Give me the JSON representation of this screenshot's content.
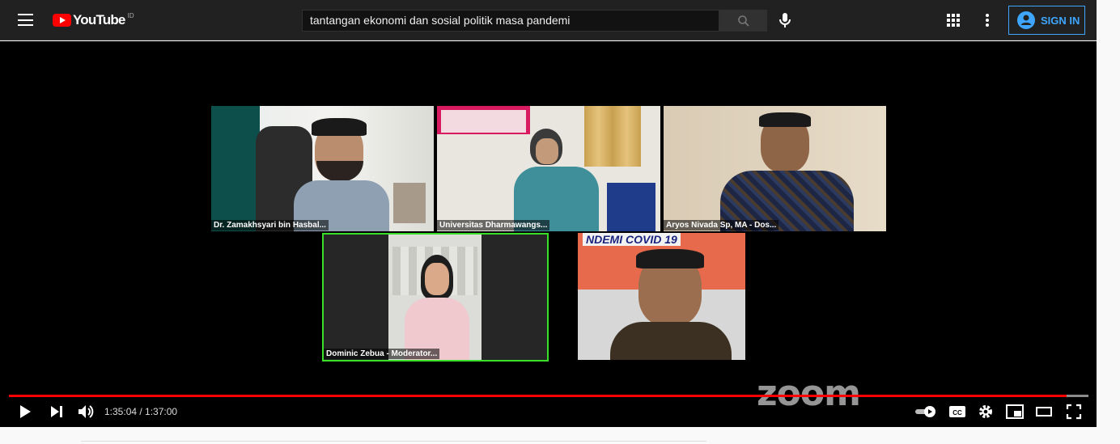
{
  "header": {
    "logo_text": "YouTube",
    "country_code": "ID",
    "search_value": "tantangan ekonomi dan sosial politik masa pandemi",
    "signin_label": "SIGN IN"
  },
  "meeting": {
    "participants": [
      {
        "name": "Dr. Zamakhsyari bin Hasbal..."
      },
      {
        "name": "Universitas Dharmawangs..."
      },
      {
        "name": "Aryos Nivada Sp, MA - Dos..."
      },
      {
        "name": "Dominic Zebua - Moderator..."
      },
      {
        "name": ""
      }
    ],
    "banner_text": "NDEMI COVID 19",
    "watermark": "zoom",
    "active_speaker_color": "#39e02a"
  },
  "player": {
    "current_time": "1:35:04",
    "duration": "1:37:00",
    "time_display": "1:35:04 / 1:37:00",
    "progress_fraction": 0.98
  },
  "icons": [
    "menu-icon",
    "youtube-logo-icon",
    "search-icon",
    "mic-icon",
    "apps-icon",
    "more-icon",
    "account-icon",
    "play-icon",
    "next-icon",
    "volume-icon",
    "autoplay-toggle-icon",
    "captions-icon",
    "settings-icon",
    "miniplayer-icon",
    "theater-icon",
    "fullscreen-icon"
  ],
  "colors": {
    "accent": "#ff0000",
    "link": "#3ea6ff"
  }
}
